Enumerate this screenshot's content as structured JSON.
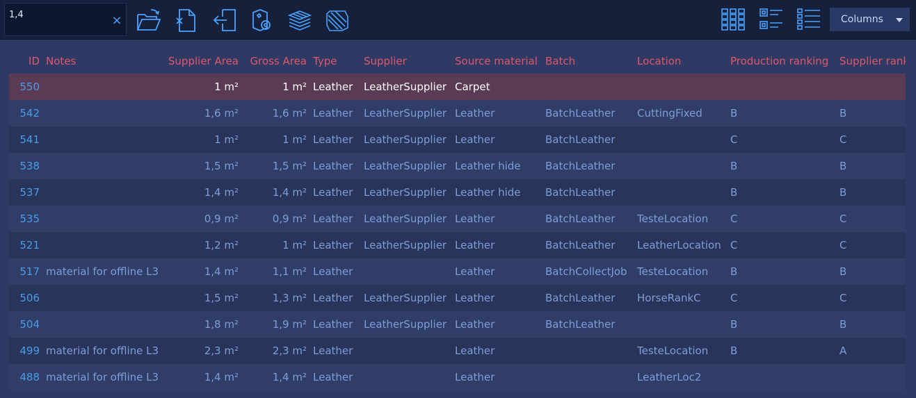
{
  "search": {
    "value": "1,4",
    "clear_label": "×"
  },
  "toolbar": {
    "tools": [
      {
        "icon": "open-folder-icon"
      },
      {
        "icon": "remove-document-icon"
      },
      {
        "icon": "import-icon"
      },
      {
        "icon": "tag-roll-icon"
      },
      {
        "icon": "material-stack-icon"
      },
      {
        "icon": "hatch-pattern-icon"
      }
    ],
    "views": [
      {
        "icon": "grid-view-icon"
      },
      {
        "icon": "tile-list-view-icon"
      },
      {
        "icon": "detail-list-view-icon"
      }
    ],
    "columns_label": "Columns"
  },
  "colors": {
    "accent": "#4aa3ff",
    "header_text": "#e0576a",
    "selected_row": "#5a3a55"
  },
  "table": {
    "headers": {
      "id": "ID",
      "notes": "Notes",
      "supplier_area": "Supplier Area",
      "gross_area": "Gross Area",
      "type": "Type",
      "supplier": "Supplier",
      "source_material": "Source material",
      "batch": "Batch",
      "location": "Location",
      "production_ranking": "Production ranking",
      "supplier_rank": "Supplier rank"
    },
    "selected_index": 0,
    "rows": [
      {
        "id": "550",
        "notes": "",
        "supplier_area": "1 m²",
        "gross_area": "1 m²",
        "type": "Leather",
        "supplier": "LeatherSupplier",
        "source_material": "Carpet",
        "batch": "",
        "location": "",
        "production_ranking": "",
        "supplier_rank": ""
      },
      {
        "id": "542",
        "notes": "",
        "supplier_area": "1,6 m²",
        "gross_area": "1,6 m²",
        "type": "Leather",
        "supplier": "LeatherSupplier",
        "source_material": "Leather",
        "batch": "BatchLeather",
        "location": "CuttingFixed",
        "production_ranking": "B",
        "supplier_rank": "B"
      },
      {
        "id": "541",
        "notes": "",
        "supplier_area": "1 m²",
        "gross_area": "1 m²",
        "type": "Leather",
        "supplier": "LeatherSupplier",
        "source_material": "Leather",
        "batch": "BatchLeather",
        "location": "",
        "production_ranking": "C",
        "supplier_rank": "C"
      },
      {
        "id": "538",
        "notes": "",
        "supplier_area": "1,5 m²",
        "gross_area": "1,5 m²",
        "type": "Leather",
        "supplier": "LeatherSupplier",
        "source_material": "Leather hide",
        "batch": "BatchLeather",
        "location": "",
        "production_ranking": "B",
        "supplier_rank": "B"
      },
      {
        "id": "537",
        "notes": "",
        "supplier_area": "1,4 m²",
        "gross_area": "1,4 m²",
        "type": "Leather",
        "supplier": "LeatherSupplier",
        "source_material": "Leather hide",
        "batch": "BatchLeather",
        "location": "",
        "production_ranking": "B",
        "supplier_rank": "B"
      },
      {
        "id": "535",
        "notes": "",
        "supplier_area": "0,9 m²",
        "gross_area": "0,9 m²",
        "type": "Leather",
        "supplier": "LeatherSupplier",
        "source_material": "Leather",
        "batch": "BatchLeather",
        "location": "TesteLocation",
        "production_ranking": "C",
        "supplier_rank": "C"
      },
      {
        "id": "521",
        "notes": "",
        "supplier_area": "1,2 m²",
        "gross_area": "1 m²",
        "type": "Leather",
        "supplier": "LeatherSupplier",
        "source_material": "Leather",
        "batch": "BatchLeather",
        "location": "LeatherLocation",
        "production_ranking": "C",
        "supplier_rank": "C"
      },
      {
        "id": "517",
        "notes": "material for offline L3",
        "supplier_area": "1,4 m²",
        "gross_area": "1,1 m²",
        "type": "Leather",
        "supplier": "",
        "source_material": "Leather",
        "batch": "BatchCollectJob",
        "location": "TesteLocation",
        "production_ranking": "B",
        "supplier_rank": "B"
      },
      {
        "id": "506",
        "notes": "",
        "supplier_area": "1,5 m²",
        "gross_area": "1,3 m²",
        "type": "Leather",
        "supplier": "LeatherSupplier",
        "source_material": "Leather",
        "batch": "BatchLeather",
        "location": "HorseRankC",
        "production_ranking": "C",
        "supplier_rank": "C"
      },
      {
        "id": "504",
        "notes": "",
        "supplier_area": "1,8 m²",
        "gross_area": "1,9 m²",
        "type": "Leather",
        "supplier": "LeatherSupplier",
        "source_material": "Leather",
        "batch": "BatchLeather",
        "location": "",
        "production_ranking": "B",
        "supplier_rank": "B"
      },
      {
        "id": "499",
        "notes": "material for offline L3",
        "supplier_area": "2,3 m²",
        "gross_area": "2,3 m²",
        "type": "Leather",
        "supplier": "",
        "source_material": "Leather",
        "batch": "",
        "location": "TesteLocation",
        "production_ranking": "B",
        "supplier_rank": "A"
      },
      {
        "id": "488",
        "notes": "material for offline L3",
        "supplier_area": "1,4 m²",
        "gross_area": "1,4 m²",
        "type": "Leather",
        "supplier": "",
        "source_material": "Leather",
        "batch": "",
        "location": "LeatherLoc2",
        "production_ranking": "",
        "supplier_rank": ""
      }
    ]
  }
}
